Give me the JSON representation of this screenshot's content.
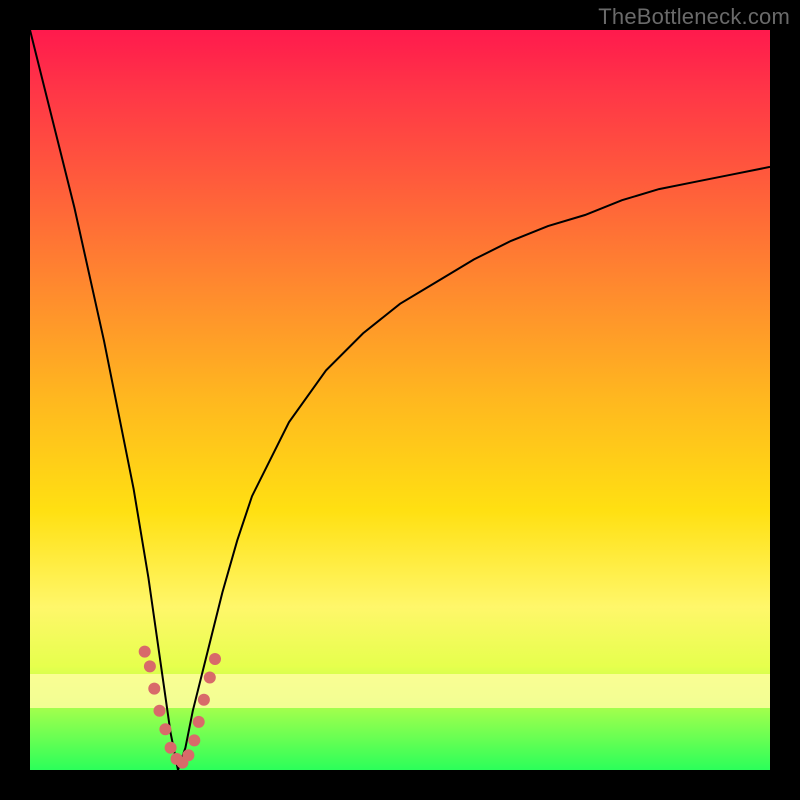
{
  "watermark": "TheBottleneck.com",
  "colors": {
    "frame": "#000000",
    "marker": "#d86a6a",
    "curve": "#000000"
  },
  "chart_data": {
    "type": "line",
    "title": "",
    "xlabel": "",
    "ylabel": "",
    "xlim": [
      0,
      100
    ],
    "ylim": [
      0,
      100
    ],
    "note": "x is a normalized horizontal position (0–100 across the plot); y is the curve height in percent of plot height. The curve drops from ~100% at the left edge to ~0% near x≈20, then rises asymptotically toward ~82% at the right edge. Marker points lie along the curve near the minimum.",
    "curve": {
      "x": [
        0,
        2,
        4,
        6,
        8,
        10,
        12,
        14,
        16,
        18,
        19,
        20,
        21,
        22,
        24,
        26,
        28,
        30,
        35,
        40,
        45,
        50,
        55,
        60,
        65,
        70,
        75,
        80,
        85,
        90,
        95,
        100
      ],
      "y": [
        100,
        92,
        84,
        76,
        67,
        58,
        48,
        38,
        26,
        12,
        5,
        0,
        3,
        8,
        16,
        24,
        31,
        37,
        47,
        54,
        59,
        63,
        66,
        69,
        71.5,
        73.5,
        75,
        77,
        78.5,
        79.5,
        80.5,
        81.5
      ]
    },
    "markers": {
      "x": [
        15.5,
        16.2,
        16.8,
        17.5,
        18.3,
        19.0,
        19.8,
        20.6,
        21.4,
        22.2,
        22.8,
        23.5,
        24.3,
        25.0
      ],
      "y": [
        16.0,
        14.0,
        11.0,
        8.0,
        5.5,
        3.0,
        1.5,
        1.0,
        2.0,
        4.0,
        6.5,
        9.5,
        12.5,
        15.0
      ]
    }
  }
}
